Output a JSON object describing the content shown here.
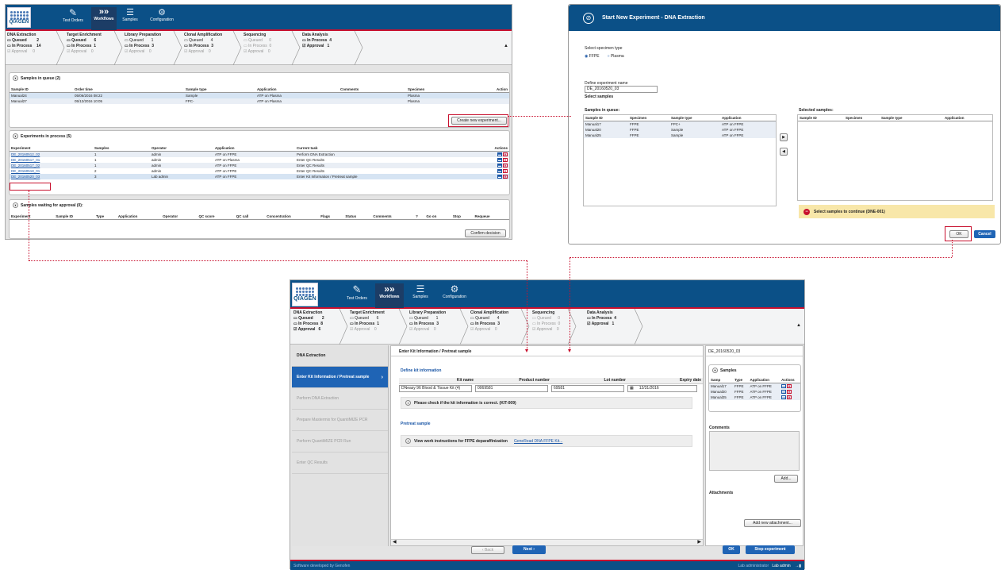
{
  "app": {
    "logo": "QIAGEN",
    "nav": [
      {
        "label": "Test Orders",
        "icon": "clipboard-icon"
      },
      {
        "label": "Workflows",
        "icon": "workflows-icon"
      },
      {
        "label": "Samples",
        "icon": "samples-icon"
      },
      {
        "label": "Configuration",
        "icon": "gears-icon"
      }
    ]
  },
  "steps_top": [
    {
      "title": "DNA Extraction",
      "l1": "Queued",
      "v1": "2",
      "l2": "In Process",
      "v2": "14",
      "l3": "Approval",
      "v3": "0"
    },
    {
      "title": "Target Enrichment",
      "l1": "Queued",
      "v1": "6",
      "l2": "In Process",
      "v2": "1",
      "l3": "Approval",
      "v3": "0"
    },
    {
      "title": "Library Preparation",
      "l1": "Queued",
      "v1": "1",
      "l2": "In Process",
      "v2": "3",
      "l3": "Approval",
      "v3": "0"
    },
    {
      "title": "Clonal Amplification",
      "l1": "Queued",
      "v1": "4",
      "l2": "In Process",
      "v2": "3",
      "l3": "Approval",
      "v3": "0"
    },
    {
      "title": "Sequencing",
      "l1": "Queued",
      "v1": "0",
      "l2": "In Process",
      "v2": "0",
      "l3": "Approval",
      "v3": "0"
    },
    {
      "title": "Data Analysis",
      "l1": "In Process",
      "v1": "4",
      "l2": "Approval",
      "v2": "1",
      "l3": "",
      "v3": ""
    }
  ],
  "steps_bottom": [
    {
      "title": "DNA Extraction",
      "l1": "Queued",
      "v1": "2",
      "l2": "In Process",
      "v2": "8",
      "l3": "Approval",
      "v3": "6"
    },
    {
      "title": "Target Enrichment",
      "l1": "Queued",
      "v1": "6",
      "l2": "In Process",
      "v2": "1",
      "l3": "Approval",
      "v3": "0"
    },
    {
      "title": "Library Preparation",
      "l1": "Queued",
      "v1": "1",
      "l2": "In Process",
      "v2": "3",
      "l3": "Approval",
      "v3": "0"
    },
    {
      "title": "Clonal Amplification",
      "l1": "Queued",
      "v1": "4",
      "l2": "In Process",
      "v2": "3",
      "l3": "Approval",
      "v3": "0"
    },
    {
      "title": "Sequencing",
      "l1": "Queued",
      "v1": "0",
      "l2": "In Process",
      "v2": "0",
      "l3": "Approval",
      "v3": "0"
    },
    {
      "title": "Data Analysis",
      "l1": "In Process",
      "v1": "4",
      "l2": "Approval",
      "v2": "1",
      "l3": "",
      "v3": ""
    }
  ],
  "queue": {
    "title": "Samples in queue (2)",
    "headers": [
      "Sample ID",
      "Order time",
      "Sample type",
      "Application",
      "Comments",
      "Specimen",
      "Action"
    ],
    "rows": [
      [
        "Manual24",
        "05/06/2016 08:22",
        "Sample",
        "ATP on Plasma",
        "",
        "Plasma",
        ""
      ],
      [
        "Manual27",
        "05/12/2016 10:05",
        "FPC-",
        "ATP on Plasma",
        "",
        "Plasma",
        ""
      ]
    ],
    "button": "Create new experiment..."
  },
  "inprocess": {
    "title": "Experiments in process (5)",
    "headers": [
      "Experiment",
      "Samples",
      "Operator",
      "Application",
      "Current task",
      "Actions"
    ],
    "rows": [
      [
        "DE_20160512_02",
        "1",
        "admin",
        "ATP on FFPE",
        "Perform DNA Extraction"
      ],
      [
        "DE_20160517_01",
        "1",
        "admin",
        "ATP on Plasma",
        "Enter QC Results"
      ],
      [
        "DE_20160517_02",
        "1",
        "admin",
        "ATP on FFPE",
        "Enter QC Results"
      ],
      [
        "DE_20160518_01",
        "2",
        "admin",
        "ATP on FFPE",
        "Enter QC Results"
      ],
      [
        "DE_20160520_03",
        "3",
        "Lab admin",
        "ATP on FFPE",
        "Enter Kit Information / Pretreat sample"
      ]
    ]
  },
  "approval": {
    "title": "Samples waiting for approval (0):",
    "headers": [
      "Experiment",
      "Sample ID",
      "Type",
      "Application",
      "Operator",
      "QC score",
      "QC call",
      "Concentration",
      "Flags",
      "Status",
      "Comments",
      "?",
      "Go on",
      "Stop",
      "Requeue"
    ],
    "button": "Confirm decision"
  },
  "dialog": {
    "title": "Start New Experiment - DNA Extraction",
    "specimen_label": "Select specimen type",
    "opt1": "FFPE",
    "opt2": "Plasma",
    "name_label": "Define experiment name",
    "name_value": "DE_20160520_03",
    "select_samples": "Select samples",
    "in_queue": "Samples in queue:",
    "selected": "Selected samples:",
    "headers": [
      "Sample ID",
      "Specimen",
      "Sample type",
      "Application"
    ],
    "rows": [
      [
        "Manual17",
        "FFPE",
        "FPC+",
        "ATP on FFPE"
      ],
      [
        "Manual20",
        "FFPE",
        "Sample",
        "ATP on FFPE"
      ],
      [
        "Manual25",
        "FFPE",
        "Sample",
        "ATP on FFPE"
      ]
    ],
    "warning": "Select samples to continue (DNE-001)",
    "ok": "OK",
    "cancel": "Cancel"
  },
  "bottom": {
    "side": [
      "DNA Extraction",
      "Enter Kit Information / Pretreat sample",
      "Perform DNA Extraction",
      "Prepare Mastermix for QuantiMIZE PCR",
      "Perform QuantiMIZE PCR Run",
      "Enter QC Results"
    ],
    "header": "Enter Kit Information / Pretreat sample",
    "define_kit": "Define kit information",
    "kit_headers": [
      "Kit name",
      "Product number",
      "Lot number",
      "Expiry date"
    ],
    "kit_values": [
      "DNeasy 96 Blood & Tissue Kit (4)",
      "0069581",
      "69581",
      "12/31/2016"
    ],
    "check_msg": "Please check if the kit information is correct. (KIT-009)",
    "pretreat": "Pretreat sample",
    "instr": "View work instructions for FFPE deparaffinization",
    "instr_link": "GeneRead DNA FFPE Kit...",
    "exp_id": "DE_20160520_03",
    "samples_title": "Samples",
    "s_headers": [
      "Samp",
      "Type",
      "Application",
      "Actions"
    ],
    "s_rows": [
      [
        "Manual17",
        "FFPE",
        "ATP on FFPE"
      ],
      [
        "Manual20",
        "FFPE",
        "ATP on FFPE"
      ],
      [
        "Manual25",
        "FFPE",
        "ATP on FFPE"
      ]
    ],
    "comments": "Comments",
    "add": "Add...",
    "attachments": "Attachments",
    "add_attach": "Add new attachment...",
    "back": "Back",
    "next": "Next",
    "ok": "OK",
    "stop": "Stop experiment",
    "footer_left": "Software developed by Genofen",
    "footer_user": "Lab administrator",
    "footer_name": "Lab admin"
  }
}
